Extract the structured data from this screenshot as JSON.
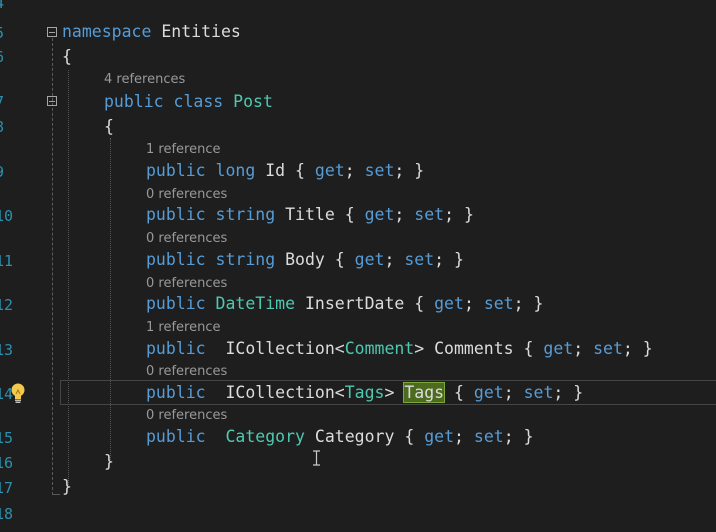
{
  "line_numbers": [
    "4",
    "5",
    "6",
    "7",
    "8",
    "9",
    "10",
    "11",
    "12",
    "13",
    "14",
    "15",
    "16",
    "17",
    "18"
  ],
  "lines": {
    "namespace": {
      "kw": "namespace",
      "name": "Entities"
    },
    "open_brace_ns": "{",
    "class_refs": "4 references",
    "class_decl": {
      "kw1": "public",
      "kw2": "class",
      "name": "Post"
    },
    "open_brace_class": "{",
    "props": [
      {
        "refs": "1 reference",
        "access": "public",
        "type": "long",
        "name": "Id",
        "tail": "{ get; set; }"
      },
      {
        "refs": "0 references",
        "access": "public",
        "type": "string",
        "name": "Title",
        "tail": "{ get; set; }"
      },
      {
        "refs": "0 references",
        "access": "public",
        "type": "string",
        "name": "Body",
        "tail": "{ get; set; }"
      },
      {
        "refs": "0 references",
        "access": "public",
        "type": "DateTime",
        "name": "InsertDate",
        "tail": "{ get; set; }"
      },
      {
        "refs": "1 reference",
        "access": "public",
        "generic": "ICollection",
        "type_arg": "Comment",
        "name": "Comments",
        "tail": "{ get; set; }"
      },
      {
        "refs": "0 references",
        "access": "public",
        "generic": "ICollection",
        "type_arg": "Tags",
        "name": "Tags",
        "tail": "{ get; set; }"
      },
      {
        "refs": "0 references",
        "access": "public",
        "type": "Category",
        "name": "Category",
        "tail": "{ get; set; }"
      }
    ],
    "close_brace_class": "}",
    "close_brace_ns": "}"
  },
  "kw": {
    "get": "get",
    "set": "set"
  },
  "colors": {
    "background": "#1e1e1e",
    "keyword": "#569cd6",
    "type": "#4ec9b0",
    "line_number": "#2b91af"
  },
  "icons": {
    "lightbulb": "lightbulb-icon"
  }
}
